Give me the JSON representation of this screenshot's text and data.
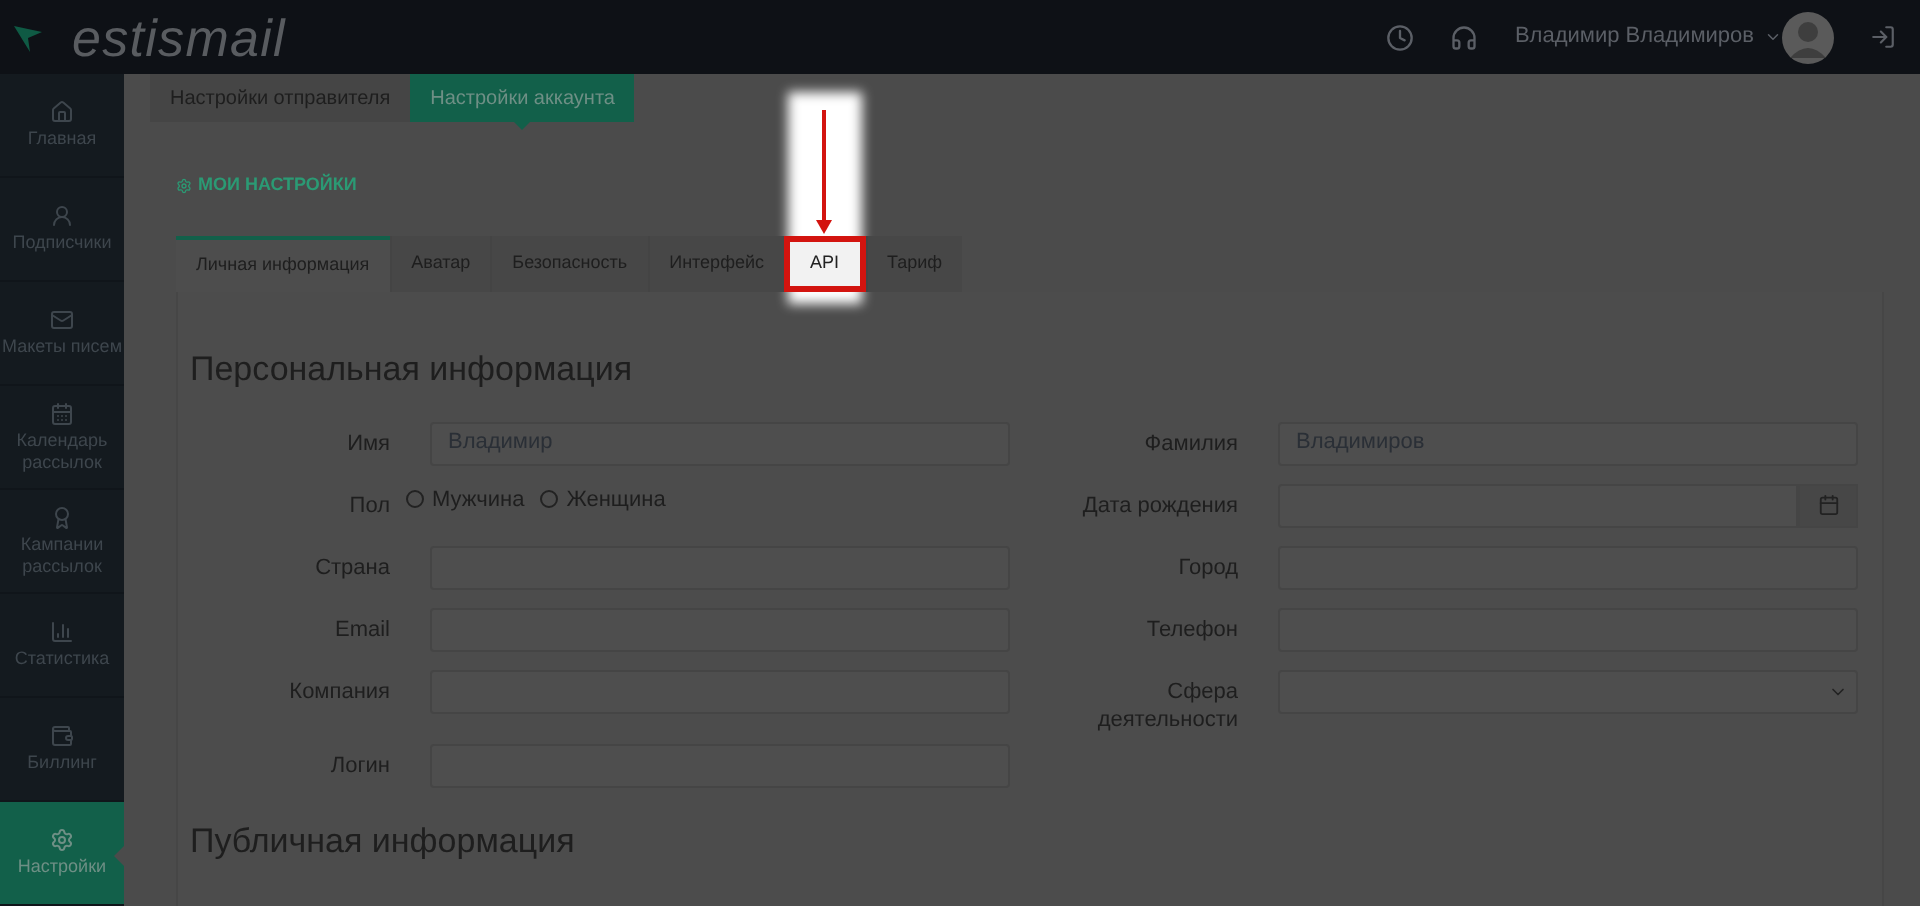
{
  "header": {
    "logo": "estismail",
    "user_name": "Владимир Владимиров"
  },
  "sidebar": {
    "items": [
      {
        "label": "Главная",
        "selected": false
      },
      {
        "label": "Подписчики",
        "selected": false
      },
      {
        "label": "Макеты писем",
        "selected": false
      },
      {
        "label": "Календарь рассылок",
        "selected": false
      },
      {
        "label": "Кампании рассылок",
        "selected": false
      },
      {
        "label": "Статистика",
        "selected": false
      },
      {
        "label": "Биллинг",
        "selected": false
      },
      {
        "label": "Настройки",
        "selected": true
      }
    ]
  },
  "top_tabs": [
    {
      "label": "Настройки отправителя",
      "selected": false
    },
    {
      "label": "Настройки аккаунта",
      "selected": true
    }
  ],
  "section_title": "МОИ НАСТРОЙКИ",
  "tabs": [
    {
      "label": "Личная информация",
      "selected": true,
      "highlighted": false
    },
    {
      "label": "Аватар",
      "selected": false,
      "highlighted": false
    },
    {
      "label": "Безопасность",
      "selected": false,
      "highlighted": false
    },
    {
      "label": "Интерфейс",
      "selected": false,
      "highlighted": false
    },
    {
      "label": "API",
      "selected": false,
      "highlighted": true
    },
    {
      "label": "Тариф",
      "selected": false,
      "highlighted": false
    }
  ],
  "personal_info": {
    "title": "Персональная информация",
    "left_fields": [
      {
        "label": "Имя",
        "kind": "text",
        "value": "Владимир"
      },
      {
        "label": "Пол",
        "kind": "radio",
        "options": [
          {
            "label": "Мужчина",
            "checked": false
          },
          {
            "label": "Женщина",
            "checked": false
          }
        ]
      },
      {
        "label": "Страна",
        "kind": "text"
      },
      {
        "label": "Email",
        "kind": "text"
      },
      {
        "label": "Компания",
        "kind": "text"
      },
      {
        "label": "Логин",
        "kind": "text"
      }
    ],
    "right_fields": [
      {
        "label": "Фамилия",
        "kind": "text",
        "value": "Владимиров"
      },
      {
        "label": "Дата рождения",
        "kind": "date"
      },
      {
        "label": "Город",
        "kind": "text"
      },
      {
        "label": "Телефон",
        "kind": "text"
      },
      {
        "label": "Сфера деятельности",
        "kind": "select"
      }
    ]
  },
  "public_info": {
    "title": "Публичная информация"
  }
}
